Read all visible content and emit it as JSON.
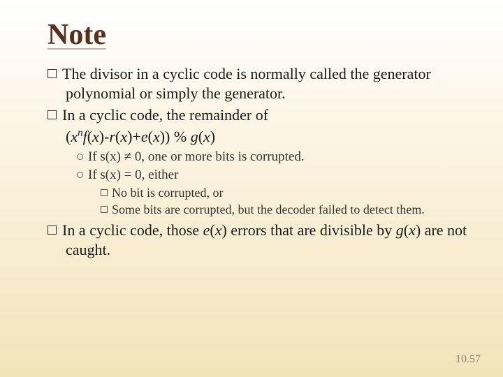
{
  "title": "Note",
  "bullets": {
    "b1": {
      "lead": "The",
      "rest": " divisor in a cyclic code is normally called the generator polynomial or simply the generator."
    },
    "b2": {
      "lead": "In",
      "rest": " a cyclic code, the remainder of"
    },
    "formula_parts": {
      "p1": "(",
      "p2": "x",
      "p3": "n",
      "p4": "f",
      "p5": "(",
      "p6": "x",
      "p7": ")-",
      "p8": "r",
      "p9": "(",
      "p10": "x",
      "p11": ")+",
      "p12": "e",
      "p13": "(",
      "p14": "x",
      "p15": ")) % ",
      "p16": "g",
      "p17": "(",
      "p18": "x",
      "p19": ")"
    },
    "sub1": "If s(x) ≠ 0, one or more bits is corrupted.",
    "sub2": "If s(x) = 0, either",
    "ssub1": "No bit is corrupted, or",
    "ssub2": "Some bits are corrupted, but the decoder failed to detect them.",
    "b3": {
      "lead": "In",
      "mid1": " a cyclic code, those ",
      "e": "e",
      "lp": "(",
      "x": "x",
      "rp": ")",
      "mid2": " errors that are divisible by ",
      "g": "g",
      "lp2": "(",
      "x2": "x",
      "rp2": ")",
      "tail": " are not caught."
    }
  },
  "footer": "10.57"
}
